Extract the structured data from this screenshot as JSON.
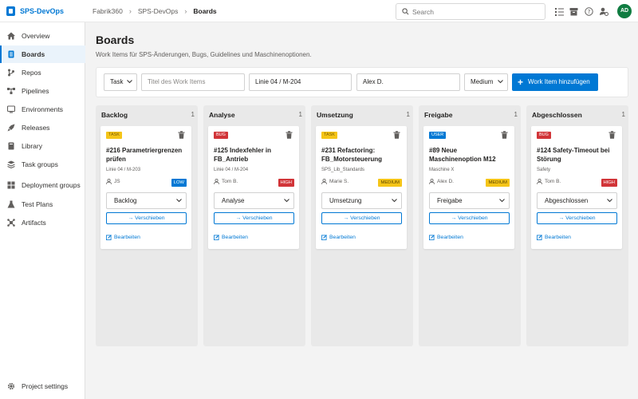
{
  "app": {
    "name": "SPS-DevOps"
  },
  "breadcrumb": [
    "Fabrik360",
    "SPS-DevOps",
    "Boards"
  ],
  "search": {
    "placeholder": "Search"
  },
  "user": {
    "initials": "AD"
  },
  "sidebar": {
    "items": [
      {
        "label": "Overview",
        "icon": "home-icon"
      },
      {
        "label": "Boards",
        "icon": "boards-icon",
        "active": true
      },
      {
        "label": "Repos",
        "icon": "repos-icon"
      },
      {
        "label": "Pipelines",
        "icon": "pipelines-icon"
      },
      {
        "label": "Environments",
        "icon": "environments-icon"
      },
      {
        "label": "Releases",
        "icon": "releases-icon"
      },
      {
        "label": "Library",
        "icon": "library-icon"
      },
      {
        "label": "Task groups",
        "icon": "task-groups-icon"
      },
      {
        "label": "Deployment groups",
        "icon": "deployment-groups-icon"
      },
      {
        "label": "Test Plans",
        "icon": "test-plans-icon"
      },
      {
        "label": "Artifacts",
        "icon": "artifacts-icon"
      }
    ],
    "settings": "Project settings"
  },
  "page": {
    "title": "Boards",
    "subtitle": "Work Items für SPS-Änderungen, Bugs, Guidelines und Maschinenoptionen."
  },
  "filters": {
    "type": "Task",
    "title_placeholder": "Titel des Work Items",
    "location": "Linie 04 / M-204",
    "assignee": "Alex D.",
    "priority": "Medium",
    "add_label": "Work Item hinzufügen"
  },
  "columns": [
    {
      "title": "Backlog",
      "count": "1",
      "card": {
        "tag": "TASK",
        "tag_type": "task",
        "title": "#216 Parametriergrenzen prüfen",
        "meta": "Linie 04 / M-203",
        "assignee": "JS",
        "priority": "LOW",
        "priority_type": "low",
        "status": "Backlog",
        "move": "Verschieben",
        "edit": "Bearbeiten"
      }
    },
    {
      "title": "Analyse",
      "count": "1",
      "card": {
        "tag": "BUG",
        "tag_type": "bug",
        "title": "#125 Indexfehler in FB_Antrieb",
        "meta": "Linie 04 / M-204",
        "assignee": "Tom B.",
        "priority": "HIGH",
        "priority_type": "high",
        "status": "Analyse",
        "move": "Verschieben",
        "edit": "Bearbeiten"
      }
    },
    {
      "title": "Umsetzung",
      "count": "1",
      "card": {
        "tag": "TASK",
        "tag_type": "task",
        "title": "#231 Refactoring: FB_Motorsteuerung",
        "meta": "SPS_Lib_Standards",
        "assignee": "Marie S.",
        "priority": "MEDIUM",
        "priority_type": "medium",
        "status": "Umsetzung",
        "move": "Verschieben",
        "edit": "Bearbeiten"
      }
    },
    {
      "title": "Freigabe",
      "count": "1",
      "card": {
        "tag": "USER",
        "tag_type": "user",
        "title": "#89 Neue Maschinenoption M12",
        "meta": "Maschine X",
        "assignee": "Alex D.",
        "priority": "MEDIUM",
        "priority_type": "medium",
        "status": "Freigabe",
        "move": "Verschieben",
        "edit": "Bearbeiten"
      }
    },
    {
      "title": "Abgeschlossen",
      "count": "1",
      "card": {
        "tag": "BUG",
        "tag_type": "bug",
        "title": "#124 Safety-Timeout bei Störung",
        "meta": "Safety",
        "assignee": "Tom B.",
        "priority": "HIGH",
        "priority_type": "high",
        "status": "Abgeschlossen",
        "move": "Verschieben",
        "edit": "Bearbeiten"
      }
    }
  ]
}
